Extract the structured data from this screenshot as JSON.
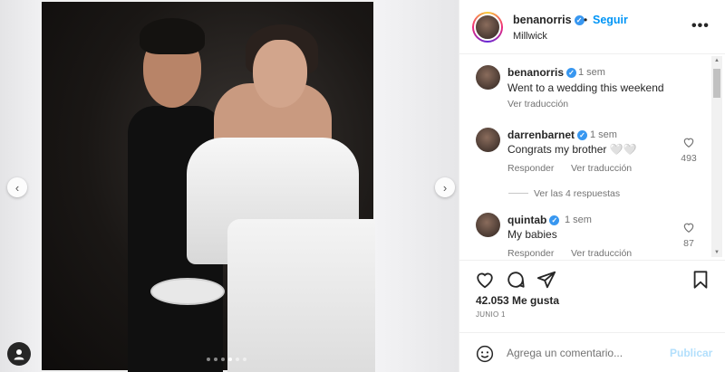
{
  "post": {
    "author": "benanorris",
    "follow_label": "Seguir",
    "separator": "•",
    "location": "Millwick",
    "more_label": "•••",
    "carousel_dots": 6,
    "carousel_active_index": 3
  },
  "comments": [
    {
      "user": "benanorris",
      "time": "1 sem",
      "text": "Went to a wedding this weekend",
      "translate_label": "Ver traducción"
    },
    {
      "user": "darrenbarnet",
      "time": "1 sem",
      "text": "Congrats my brother 🤍🤍",
      "reply_label": "Responder",
      "translate_label": "Ver traducción",
      "likes": "493",
      "view_replies_label": "Ver las 4 respuestas"
    },
    {
      "user": "quintab",
      "time": "1 sem",
      "text": "My babies",
      "reply_label": "Responder",
      "translate_label": "Ver traducción",
      "likes": "87"
    }
  ],
  "footer": {
    "likes_text": "42.053 Me gusta",
    "date_text": "JUNIO 1",
    "comment_placeholder": "Agrega un comentario...",
    "publish_label": "Publicar"
  },
  "colors": {
    "accent": "#0095f6",
    "verified": "#3897f0",
    "muted": "#737373",
    "publish_disabled": "#b2dffc"
  }
}
